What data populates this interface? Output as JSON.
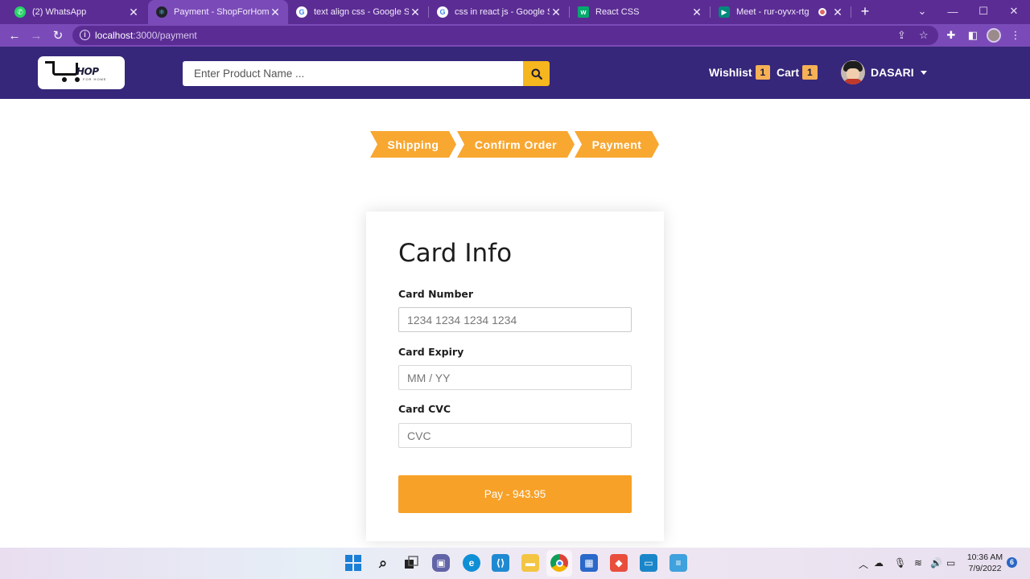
{
  "browser": {
    "tabs": [
      {
        "title": "(2) WhatsApp",
        "active": false,
        "icon": "whatsapp-icon",
        "color": "#25d366"
      },
      {
        "title": "Payment - ShopForHome",
        "active": true,
        "icon": "react-icon",
        "color": "#61dafb"
      },
      {
        "title": "text align css - Google Sear",
        "active": false,
        "icon": "google-icon",
        "color": "#4285f4"
      },
      {
        "title": "css in react js - Google Sear",
        "active": false,
        "icon": "google-icon",
        "color": "#4285f4"
      },
      {
        "title": "React CSS",
        "active": false,
        "icon": "w3schools-icon",
        "color": "#04aa6d"
      },
      {
        "title": "Meet - rur-oyvx-rtg",
        "active": false,
        "icon": "meet-icon",
        "color": "#00897b"
      }
    ],
    "url_host": "localhost",
    "url_path": ":3000/payment"
  },
  "header": {
    "logo_text": "HOP",
    "logo_subtext": "FOR HOME",
    "search_placeholder": "Enter Product Name ...",
    "wishlist_label": "Wishlist",
    "wishlist_count": "1",
    "cart_label": "Cart",
    "cart_count": "1",
    "username": "DASARI"
  },
  "steps": [
    "Shipping",
    "Confirm Order",
    "Payment"
  ],
  "payment": {
    "title": "Card Info",
    "card_number_label": "Card Number",
    "card_number_placeholder": "1234 1234 1234 1234",
    "card_expiry_label": "Card Expiry",
    "card_expiry_placeholder": "MM / YY",
    "card_cvc_label": "Card CVC",
    "card_cvc_placeholder": "CVC",
    "pay_button": "Pay - 943.95"
  },
  "taskbar": {
    "time": "10:36 AM",
    "date": "7/9/2022",
    "notifications": "6"
  },
  "colors": {
    "accent": "#f7a128",
    "header_bg": "#36277a",
    "browser_frame": "#5b2d94"
  }
}
